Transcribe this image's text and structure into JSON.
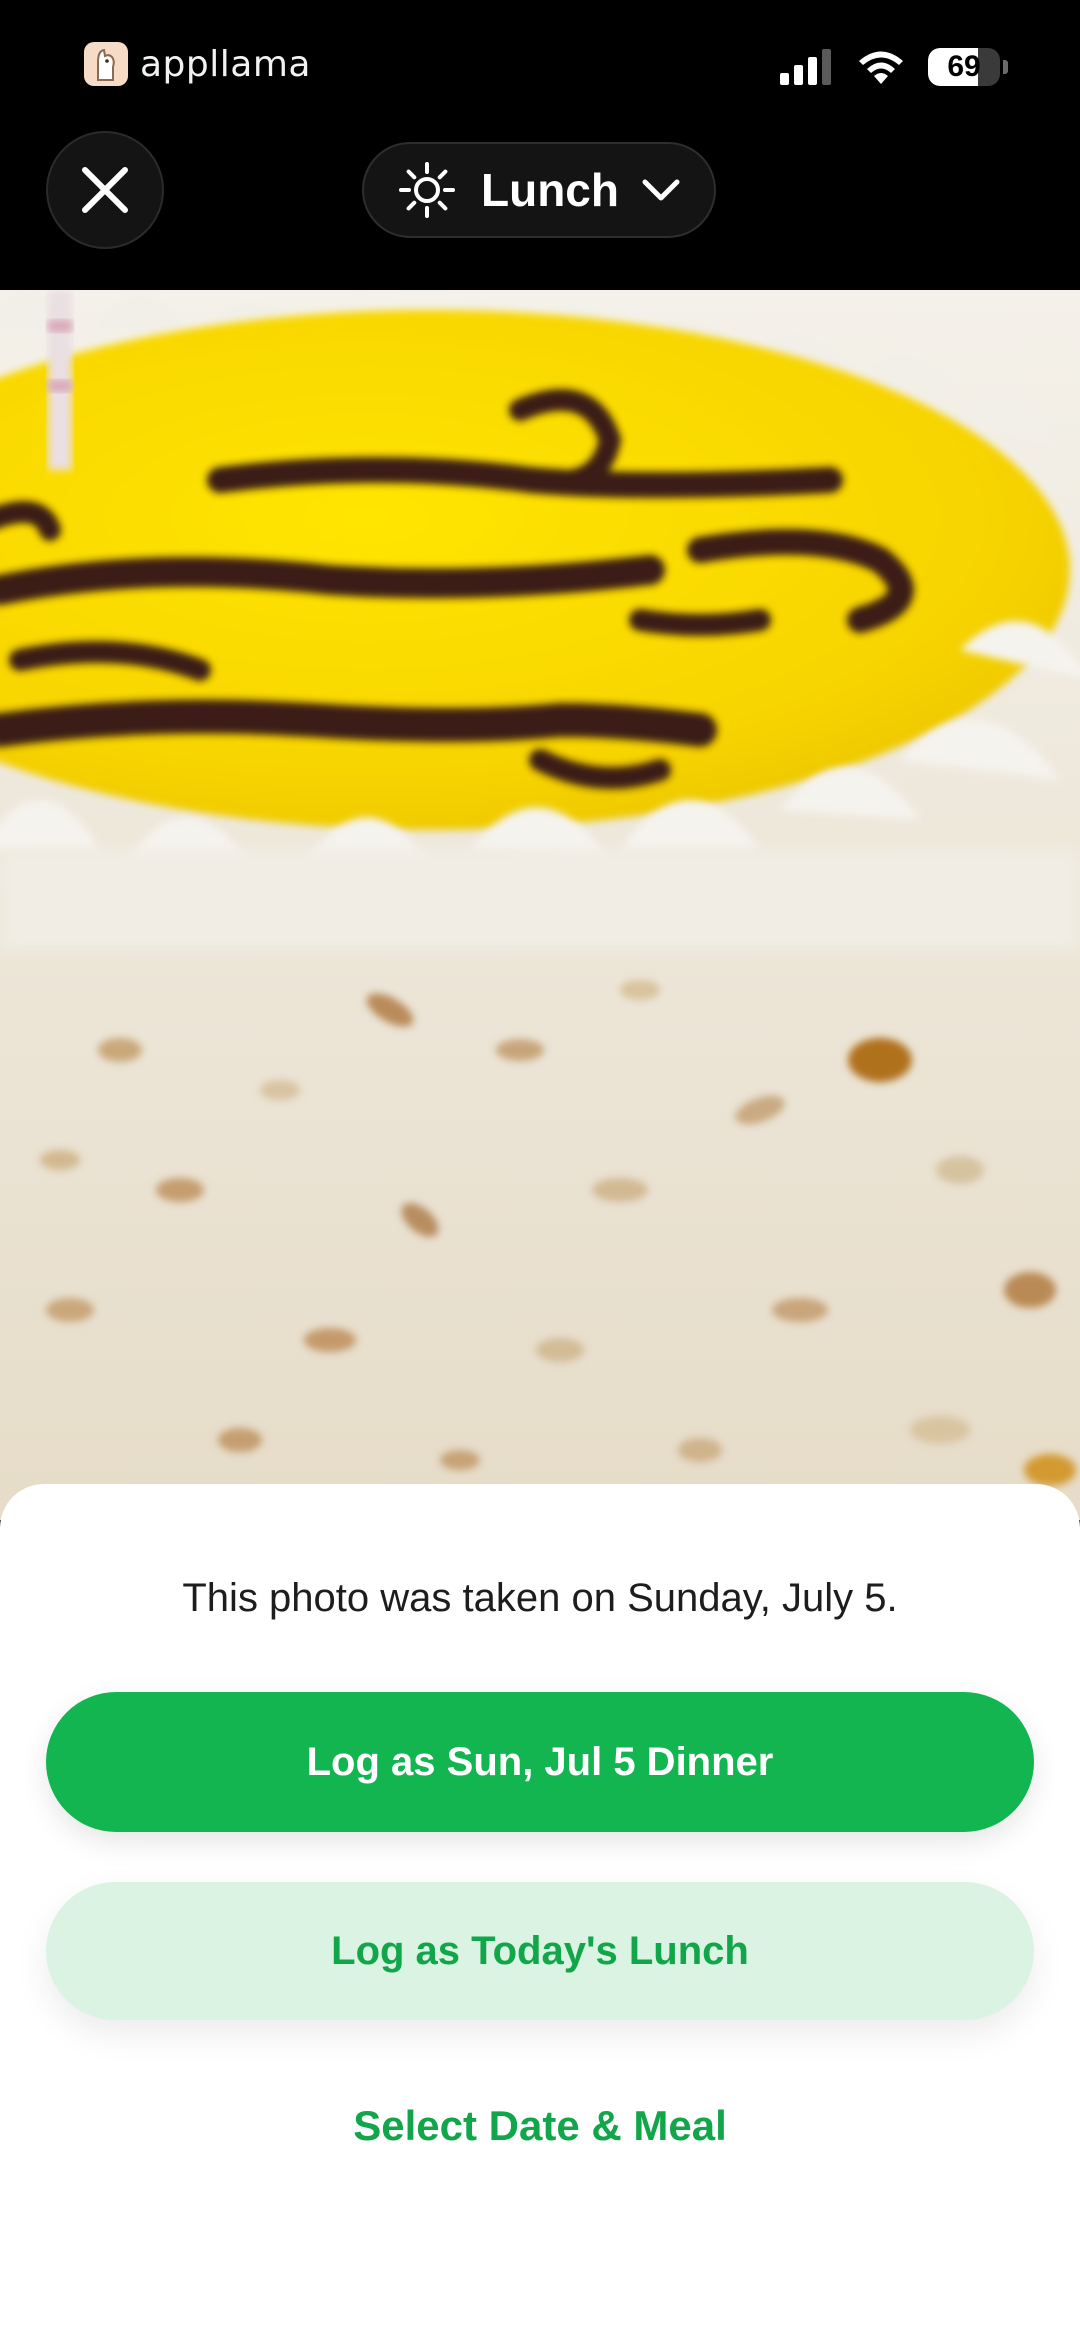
{
  "status_bar": {
    "brand_name": "appllama",
    "battery_percent": "69",
    "battery_level": 0.69
  },
  "header": {
    "meal_label": "Lunch",
    "meal_icon": "sun-icon",
    "close_icon": "close-icon",
    "dropdown_icon": "chevron-down-icon"
  },
  "sheet": {
    "info_text": "This photo was taken on Sunday, July 5.",
    "primary_button_label": "Log as Sun, Jul 5 Dinner",
    "secondary_button_label": "Log as Today's Lunch",
    "select_link_label": "Select Date & Meal"
  },
  "colors": {
    "accent_green": "#12b550",
    "secondary_bg": "#daf3e2",
    "link_green": "#10a649"
  }
}
